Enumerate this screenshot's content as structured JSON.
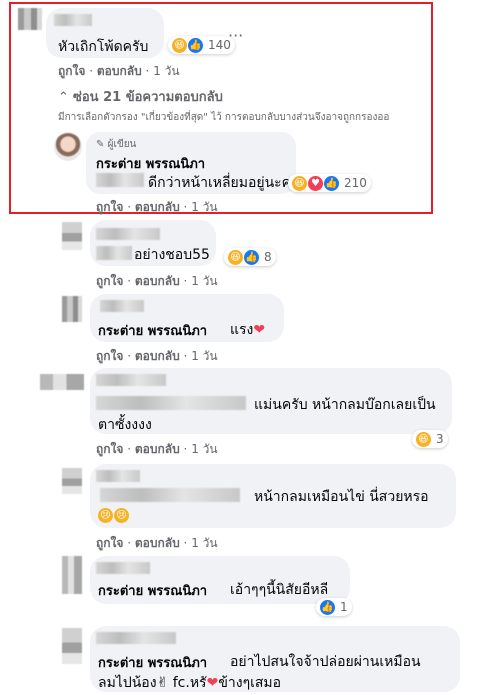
{
  "comments": [
    {
      "text": "หัวเถิกโพ้ดครับ",
      "reaction_count": "140",
      "like_label": "ถูกใจ",
      "reply_label": "ตอบกลับ",
      "time": "1 วัน",
      "more": "···"
    },
    {
      "hide_replies": "ซ่อน 21 ข้อความตอบกลับ",
      "filter_notice": "มีการเลือกตัวกรอง \"เกี่ยวข้องที่สุด\" ไว้ การตอบกลับบางส่วนจึงอาจถูกกรองออ",
      "author_badge": "ผู้เขียน",
      "author_name": "กระต่าย พรรณนิภา",
      "text": "ดีกว่าหน้าเหลี่ยมอยู่นะคะ",
      "reaction_count": "210",
      "like_label": "ถูกใจ",
      "reply_label": "ตอบกลับ",
      "time": "1 วัน"
    },
    {
      "text": "อย่างชอบ55",
      "reaction_count": "8",
      "like_label": "ถูกใจ",
      "reply_label": "ตอบกลับ",
      "time": "1 วัน"
    },
    {
      "author_name": "กระต่าย พรรณนิภา",
      "text": "แรง",
      "like_label": "ถูกใจ",
      "reply_label": "ตอบกลับ",
      "time": "1 วัน"
    },
    {
      "text_line1": "แม่นครับ หน้ากลมบ๊อกเลยเป็น",
      "text_line2": "ตาซั้งงงง",
      "reaction_count": "3",
      "like_label": "ถูกใจ",
      "reply_label": "ตอบกลับ",
      "time": "1 วัน"
    },
    {
      "text": "หน้ากลมเหมือนไข่ นี่สวยหรอ",
      "like_label": "ถูกใจ",
      "reply_label": "ตอบกลับ",
      "time": "1 วัน"
    },
    {
      "author_name": "กระต่าย พรรณนิภา",
      "text": "เอ้าๆๆนี้นิสัยอีหลี",
      "reaction_count": "1",
      "like_label": "ถูกใจ",
      "reply_label": "ตอบกลับ",
      "time": "1 วัน"
    },
    {
      "author_name": "กระต่าย พรรณนิภา",
      "text_line1": "อย่าไปสนใจจ้าปล่อยผ่านเหมือน",
      "text_line2": "ลมไปน้อง",
      "text_line2b": "fc.หรั",
      "text_line2c": "ข้างๆเสมอ"
    }
  ],
  "colors": {
    "highlight": "#e41e2b",
    "bubble": "#f0f2f5",
    "like": "#1877f2",
    "haha": "#f7b125",
    "love": "#f33e58"
  }
}
